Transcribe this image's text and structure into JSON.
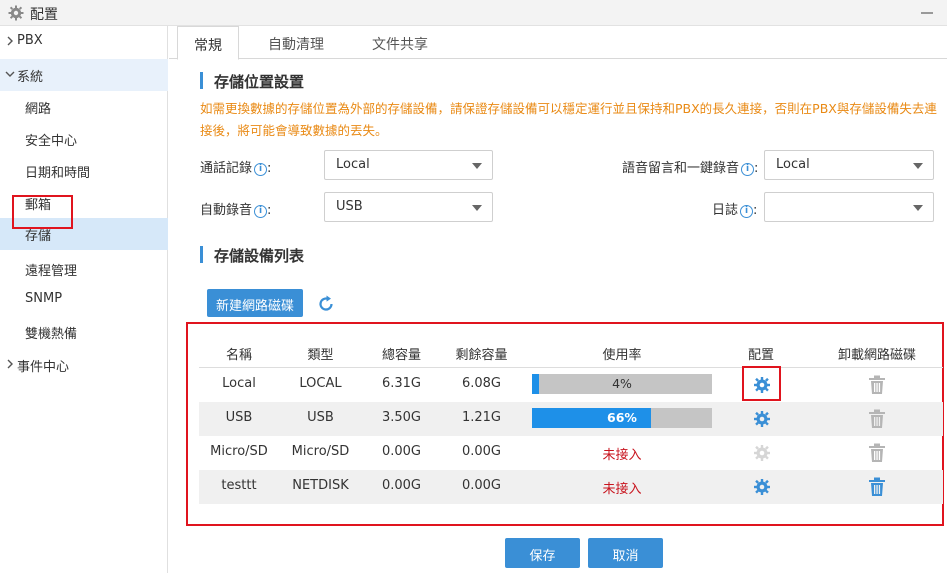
{
  "window": {
    "title": "配置"
  },
  "sidebar": {
    "items": [
      {
        "label": "PBX",
        "level": "top",
        "expanded": false
      },
      {
        "label": "系統",
        "level": "top",
        "expanded": true
      },
      {
        "label": "網路",
        "level": "sub"
      },
      {
        "label": "安全中心",
        "level": "sub"
      },
      {
        "label": "日期和時間",
        "level": "sub"
      },
      {
        "label": "郵箱",
        "level": "sub"
      },
      {
        "label": "存儲",
        "level": "sub",
        "active": true
      },
      {
        "label": "遠程管理",
        "level": "sub"
      },
      {
        "label": "SNMP",
        "level": "sub"
      },
      {
        "label": "雙機熱備",
        "level": "sub"
      },
      {
        "label": "事件中心",
        "level": "top",
        "expanded": false
      }
    ]
  },
  "tabs": [
    {
      "label": "常規",
      "active": true
    },
    {
      "label": "自動清理",
      "active": false
    },
    {
      "label": "文件共享",
      "active": false
    }
  ],
  "storage_location": {
    "title": "存儲位置設置",
    "warning": "如需更換數據的存儲位置為外部的存儲設備，請保證存儲設備可以穩定運行並且保持和PBX的長久連接，否則在PBX與存儲設備失去連接後，將可能會導致數據的丟失。",
    "fields": {
      "call_records": {
        "label": "通話記錄",
        "value": "Local"
      },
      "voicemail": {
        "label": "語音留言和一鍵錄音",
        "value": "Local"
      },
      "auto_record": {
        "label": "自動錄音",
        "value": "USB"
      },
      "log": {
        "label": "日誌",
        "value": ""
      }
    }
  },
  "device_list": {
    "title": "存儲設備列表",
    "add_button": "新建網路磁碟",
    "columns": [
      "名稱",
      "類型",
      "總容量",
      "剩餘容量",
      "使用率",
      "配置",
      "卸載網路磁碟"
    ],
    "rows": [
      {
        "name": "Local",
        "type": "LOCAL",
        "total": "6.31G",
        "free": "6.08G",
        "usage_label": "4%",
        "usage_pct": 4,
        "connected": true,
        "config_enabled": true,
        "unmount_enabled": false
      },
      {
        "name": "USB",
        "type": "USB",
        "total": "3.50G",
        "free": "1.21G",
        "usage_label": "66%",
        "usage_pct": 66,
        "connected": true,
        "config_enabled": true,
        "unmount_enabled": false
      },
      {
        "name": "Micro/SD",
        "type": "Micro/SD",
        "total": "0.00G",
        "free": "0.00G",
        "usage_label": "未接入",
        "connected": false,
        "config_enabled": false,
        "unmount_enabled": false
      },
      {
        "name": "testtt",
        "type": "NETDISK",
        "total": "0.00G",
        "free": "0.00G",
        "usage_label": "未接入",
        "connected": false,
        "config_enabled": true,
        "unmount_enabled": true
      }
    ]
  },
  "footer": {
    "save": "保存",
    "cancel": "取消"
  },
  "colors": {
    "accent": "#3a8fd6",
    "warning": "#e98a15",
    "error": "#c8141e",
    "highlight": "#e0141e"
  }
}
